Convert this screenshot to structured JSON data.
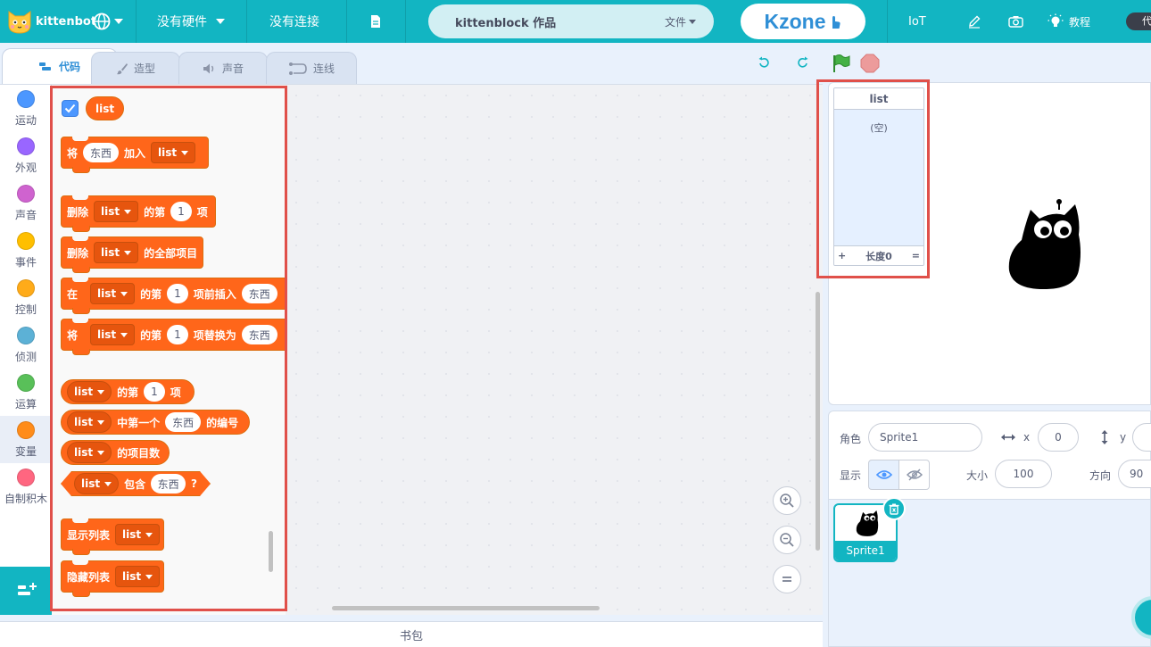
{
  "menubar": {
    "brand": "kittenbot",
    "hardware_label": "没有硬件",
    "connection_label": "没有连接",
    "project_title": "kittenblock 作品",
    "file_menu": "文件",
    "kzone_label": "Kzone",
    "iot_label": "IoT",
    "tutorial_label": "教程",
    "mode_toggle": "代",
    "icons": [
      "cat-logo-icon",
      "globe-icon",
      "file-icon",
      "hand-pointer-icon",
      "pencil-icon",
      "camera-icon",
      "lightbulb-icon"
    ]
  },
  "tabs": [
    {
      "label": "代码",
      "icon": "code-icon",
      "active": true
    },
    {
      "label": "造型",
      "icon": "brush-icon"
    },
    {
      "label": "声音",
      "icon": "speaker-icon"
    },
    {
      "label": "连线",
      "icon": "wiring-icon"
    }
  ],
  "stage_controls": [
    "rotate-left-icon",
    "rotate-right-icon",
    "green-flag-icon",
    "stop-icon"
  ],
  "categories": [
    {
      "label": "运动",
      "color": "#4c97ff"
    },
    {
      "label": "外观",
      "color": "#9966ff"
    },
    {
      "label": "声音",
      "color": "#cf63cf"
    },
    {
      "label": "事件",
      "color": "#ffbf00"
    },
    {
      "label": "控制",
      "color": "#ffab19"
    },
    {
      "label": "侦测",
      "color": "#5cb1d6"
    },
    {
      "label": "运算",
      "color": "#59c059"
    },
    {
      "label": "变量",
      "color": "#ff8c1a",
      "active": true
    },
    {
      "label": "自制积木",
      "color": "#ff6680"
    }
  ],
  "palette": {
    "list_name": "list",
    "list_checked": true,
    "add": {
      "prefix": "将",
      "item": "东西",
      "mid": "加入",
      "list": "list"
    },
    "delete_item": {
      "prefix": "删除",
      "list": "list",
      "mid": "的第",
      "index": "1",
      "suffix": "项"
    },
    "delete_all": {
      "prefix": "删除",
      "list": "list",
      "suffix": "的全部项目"
    },
    "insert": {
      "prefix": "在",
      "list": "list",
      "mid": "的第",
      "index": "1",
      "mid2": "项前插入",
      "item": "东西"
    },
    "replace": {
      "prefix": "将",
      "list": "list",
      "mid": "的第",
      "index": "1",
      "mid2": "项替换为",
      "item": "东西"
    },
    "item_of": {
      "list": "list",
      "mid": "的第",
      "index": "1",
      "suffix": "项"
    },
    "index_of": {
      "list": "list",
      "mid": "中第一个",
      "item": "东西",
      "suffix": "的编号"
    },
    "length": {
      "list": "list",
      "suffix": "的项目数"
    },
    "contains": {
      "list": "list",
      "mid": "包含",
      "item": "东西",
      "suffix": "?"
    },
    "show": {
      "prefix": "显示列表",
      "list": "list"
    },
    "hide": {
      "prefix": "隐藏列表",
      "list": "list"
    }
  },
  "zoom_controls": [
    "zoom-in-icon",
    "zoom-out-icon",
    "zoom-reset-icon"
  ],
  "backpack_label": "书包",
  "stage": {
    "list_monitor": {
      "title": "list",
      "empty_text": "(空)",
      "add_symbol": "+",
      "length_label": "长度0",
      "resize_symbol": "="
    }
  },
  "sprite_info": {
    "sprite_label": "角色",
    "sprite_name": "Sprite1",
    "x_label": "x",
    "x_value": "0",
    "y_label": "y",
    "show_label": "显示",
    "size_label": "大小",
    "size_value": "100",
    "direction_label": "方向",
    "direction_value": "90"
  },
  "sprites": [
    {
      "name": "Sprite1",
      "selected": true
    }
  ],
  "highlight_color": "#e0504a",
  "accent_color": "#12b5c2",
  "list_block_color": "#ff661a"
}
